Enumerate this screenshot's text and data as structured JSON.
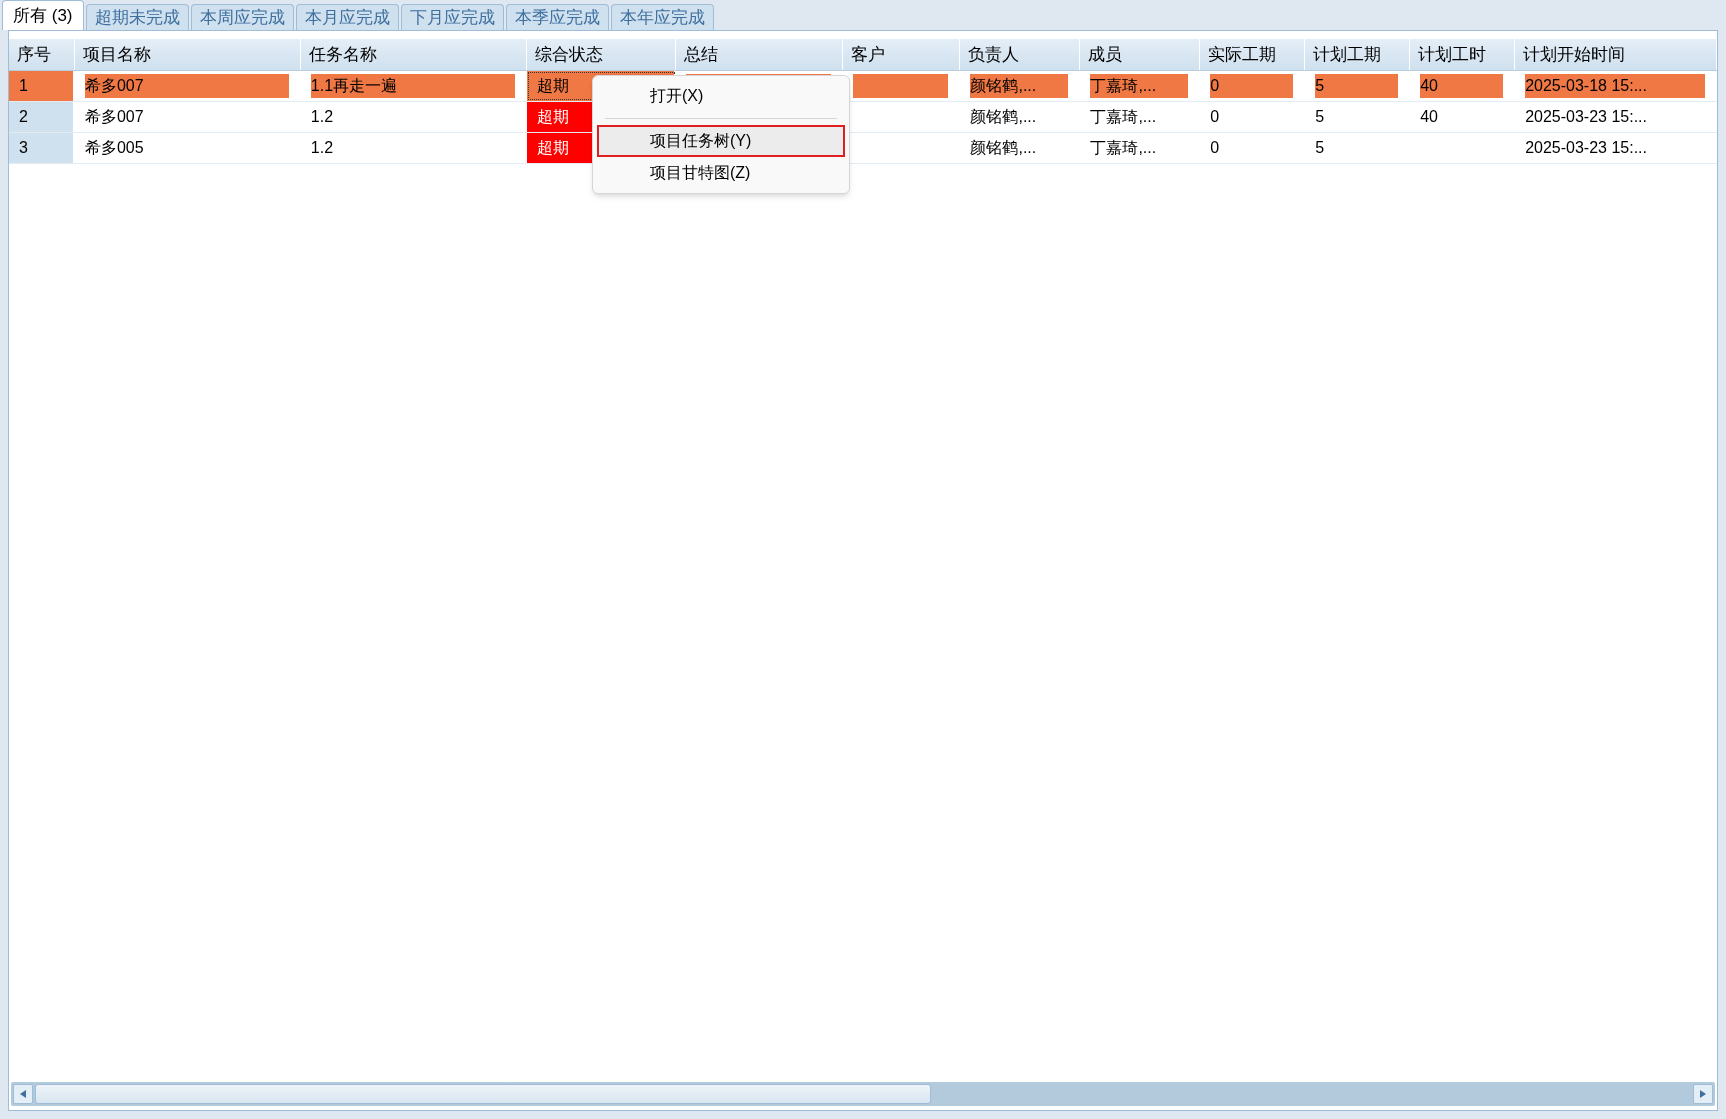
{
  "tabs": [
    {
      "label": "所有 (3)",
      "selected": true
    },
    {
      "label": "超期未完成",
      "selected": false
    },
    {
      "label": "本周应完成",
      "selected": false
    },
    {
      "label": "本月应完成",
      "selected": false
    },
    {
      "label": "下月应完成",
      "selected": false
    },
    {
      "label": "本季应完成",
      "selected": false
    },
    {
      "label": "本年应完成",
      "selected": false
    }
  ],
  "table": {
    "columns": [
      "序号",
      "项目名称",
      "任务名称",
      "综合状态",
      "总结",
      "客户",
      "负责人",
      "成员",
      "实际工期",
      "计划工期",
      "计划工时",
      "计划开始时间"
    ],
    "rows": [
      {
        "selected": true,
        "focused_status": true,
        "cells": [
          "1",
          "希多007",
          "1.1再走一遍",
          "超期",
          "",
          "",
          "颜铭鹤,...",
          "丁嘉琦,...",
          "0",
          "5",
          "40",
          "2025-03-18 15:..."
        ]
      },
      {
        "selected": false,
        "focused_status": false,
        "cells": [
          "2",
          "希多007",
          "1.2",
          "超期",
          "",
          "",
          "颜铭鹤,...",
          "丁嘉琦,...",
          "0",
          "5",
          "40",
          "2025-03-23 15:..."
        ]
      },
      {
        "selected": false,
        "focused_status": false,
        "cells": [
          "3",
          "希多005",
          "1.2",
          "超期",
          "",
          "",
          "颜铭鹤,...",
          "丁嘉琦,...",
          "0",
          "5",
          "",
          "2025-03-23 15:..."
        ]
      }
    ]
  },
  "context_menu": {
    "items": [
      {
        "kind": "item",
        "label": "打开(X)",
        "selected": false
      },
      {
        "kind": "separator"
      },
      {
        "kind": "item",
        "label": "项目任务树(Y)",
        "selected": true
      },
      {
        "kind": "item",
        "label": "项目甘特图(Z)",
        "selected": false
      }
    ]
  }
}
